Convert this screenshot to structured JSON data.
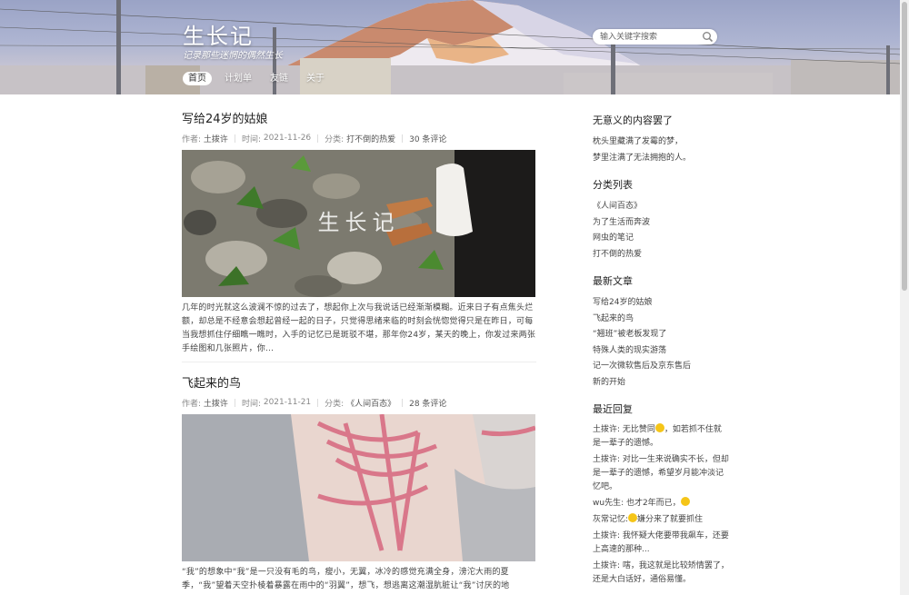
{
  "header": {
    "title": "生长记",
    "subtitle": "记录那些迷惘的偶然生长",
    "nav": [
      "首页",
      "计划单",
      "友链",
      "关于"
    ],
    "search_placeholder": "输入关键字搜索",
    "search_icon": "search-icon"
  },
  "posts": [
    {
      "title": "写给24岁的姑娘",
      "author_label": "作者:",
      "author": "土拨许",
      "time_label": "时间:",
      "time": "2021-11-26",
      "category_label": "分类:",
      "category": "打不倒的热爱",
      "comments": "30 条评论",
      "image_overlay": "生长记",
      "excerpt": "几年的时光就这么波澜不惊的过去了，想起你上次与我说话已经渐渐模糊。近来日子有点焦头烂额，却总是不经意会想起曾经一起的日子，只觉得思绪来临的时刻会恍惚觉得只是在昨日，可每当我想抓住仔细瞧一瞧时，入手的记忆已是斑驳不堪，那年你24岁，某天的晚上，你发过来两张手绘图和几张照片，你..."
    },
    {
      "title": "飞起来的鸟",
      "author_label": "作者:",
      "author": "土拨许",
      "time_label": "时间:",
      "time": "2021-11-21",
      "category_label": "分类:",
      "category": "《人间百态》",
      "comments": "28 条评论",
      "excerpt": "“我”的想象中“我”是一只没有毛的鸟，瘦小，无翼，冰冷的感觉充满全身，滂沱大雨的夏季，“我”望着天空扑棱着暴露在雨中的“羽翼”，想飞，想逃离这潮湿肮脏让“我”讨厌的地"
    }
  ],
  "sidebar": {
    "quote": {
      "title": "无意义的内容罢了",
      "lines": [
        "枕头里藏满了发霉的梦，",
        "梦里注满了无法拥抱的人。"
      ]
    },
    "categories": {
      "title": "分类列表",
      "items": [
        "《人间百态》",
        "为了生活而奔波",
        "网虫的笔记",
        "打不倒的热爱"
      ]
    },
    "recent_posts": {
      "title": "最新文章",
      "items": [
        "写给24岁的姑娘",
        "飞起来的鸟",
        "“翘班”被老板发现了",
        "特殊人类的现实游荡",
        "记一次微软售后及京东售后",
        "新的开始"
      ]
    },
    "recent_replies": {
      "title": "最近回复",
      "items": [
        {
          "a": "土拨许: 无比赞同",
          "b": "，如若抓不住就是一辈子的遗憾。",
          "emoji": "thumbs-up-icon"
        },
        {
          "a": "土拨许: 对比一生来说确实不长，但却是一辈子的遗憾，希望岁月能冲淡记忆吧。",
          "b": "",
          "emoji": ""
        },
        {
          "a": "wu先生: 也才2年而已，",
          "b": "",
          "emoji": "smile-icon"
        },
        {
          "a": "灰常记忆:",
          "b": "嫌分来了就要抓住",
          "emoji": "smile-icon"
        },
        {
          "a": "土拨许: 我怀疑大佬要带我飙车，还要上高速的那种...",
          "b": "",
          "emoji": ""
        },
        {
          "a": "土拨许: 嗐，我这就是比较矫情罢了，还是大白话好，通俗易懂。",
          "b": "",
          "emoji": ""
        }
      ]
    }
  }
}
